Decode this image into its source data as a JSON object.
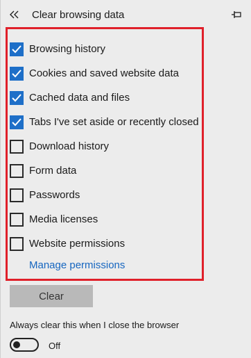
{
  "header": {
    "title": "Clear browsing data",
    "back_icon": "double-chevron-left-icon",
    "pin_icon": "pin-icon"
  },
  "options": [
    {
      "label": "Browsing history",
      "checked": true
    },
    {
      "label": "Cookies and saved website data",
      "checked": true
    },
    {
      "label": "Cached data and files",
      "checked": true
    },
    {
      "label": "Tabs I've set aside or recently closed",
      "checked": true
    },
    {
      "label": "Download history",
      "checked": false
    },
    {
      "label": "Form data",
      "checked": false
    },
    {
      "label": "Passwords",
      "checked": false
    },
    {
      "label": "Media licenses",
      "checked": false
    },
    {
      "label": "Website permissions",
      "checked": false
    }
  ],
  "manage_permissions_label": "Manage permissions",
  "clear_button_label": "Clear",
  "always_clear": {
    "label": "Always clear this when I close the browser",
    "state_label": "Off",
    "on": false
  },
  "colors": {
    "accent": "#1e6fc8",
    "link": "#1666c0",
    "highlight": "#e0202a",
    "background": "#ececec"
  }
}
